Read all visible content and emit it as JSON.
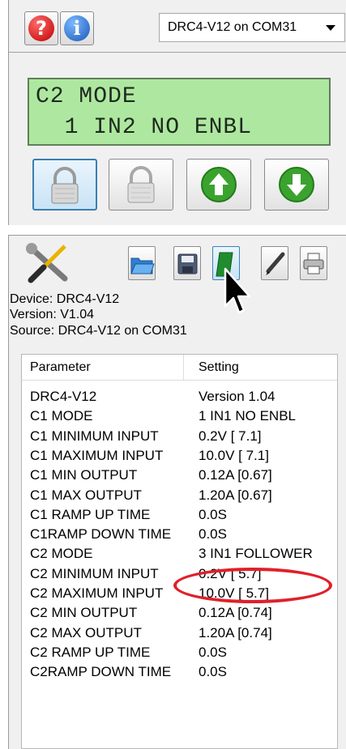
{
  "toolbar": {
    "help_icon": "help-icon",
    "info_icon": "info-icon",
    "port_select": "DRC4-V12 on COM31"
  },
  "lcd": {
    "line1": "C2 MODE",
    "line2": "  1 IN2 NO ENBL"
  },
  "control_buttons": [
    "lock-icon",
    "unlock-icon",
    "arrow-up-icon",
    "arrow-down-icon"
  ],
  "tools": [
    "wrench-screwdriver-icon",
    "open-folder-icon",
    "save-disk-icon",
    "book-icon",
    "pen-icon",
    "printer-icon"
  ],
  "device_info": {
    "device": "Device: DRC4-V12",
    "version": "Version: V1.04",
    "source": "Source: DRC4-V12 on COM31"
  },
  "table": {
    "headers": [
      "Parameter",
      "Setting"
    ],
    "rows": [
      {
        "param": "DRC4-V12",
        "setting": "Version 1.04"
      },
      {
        "param": "C1 MODE",
        "setting": "1 IN1 NO ENBL"
      },
      {
        "param": "C1 MINIMUM INPUT",
        "setting": "0.2V [ 7.1]"
      },
      {
        "param": "C1 MAXIMUM INPUT",
        "setting": "10.0V [ 7.1]"
      },
      {
        "param": "C1 MIN OUTPUT",
        "setting": "0.12A [0.67]"
      },
      {
        "param": "C1 MAX OUTPUT",
        "setting": "1.20A [0.67]"
      },
      {
        "param": "C1 RAMP UP TIME",
        "setting": "0.0S"
      },
      {
        "param": "C1RAMP DOWN TIME",
        "setting": "0.0S"
      },
      {
        "param": "C2 MODE",
        "setting": "3 IN1 FOLLOWER"
      },
      {
        "param": "C2 MINIMUM INPUT",
        "setting": "0.2V [ 5.7]"
      },
      {
        "param": "C2 MAXIMUM INPUT",
        "setting": "10.0V [ 5.7]"
      },
      {
        "param": "C2 MIN OUTPUT",
        "setting": "0.12A [0.74]"
      },
      {
        "param": "C2 MAX OUTPUT",
        "setting": "1.20A [0.74]"
      },
      {
        "param": "C2 RAMP UP TIME",
        "setting": "0.0S"
      },
      {
        "param": "C2RAMP DOWN TIME",
        "setting": "0.0S"
      }
    ]
  },
  "colors": {
    "lcd_background": "#aee8a0",
    "highlight_circle": "#e0202a",
    "active_button_border": "#3c7fb1"
  }
}
